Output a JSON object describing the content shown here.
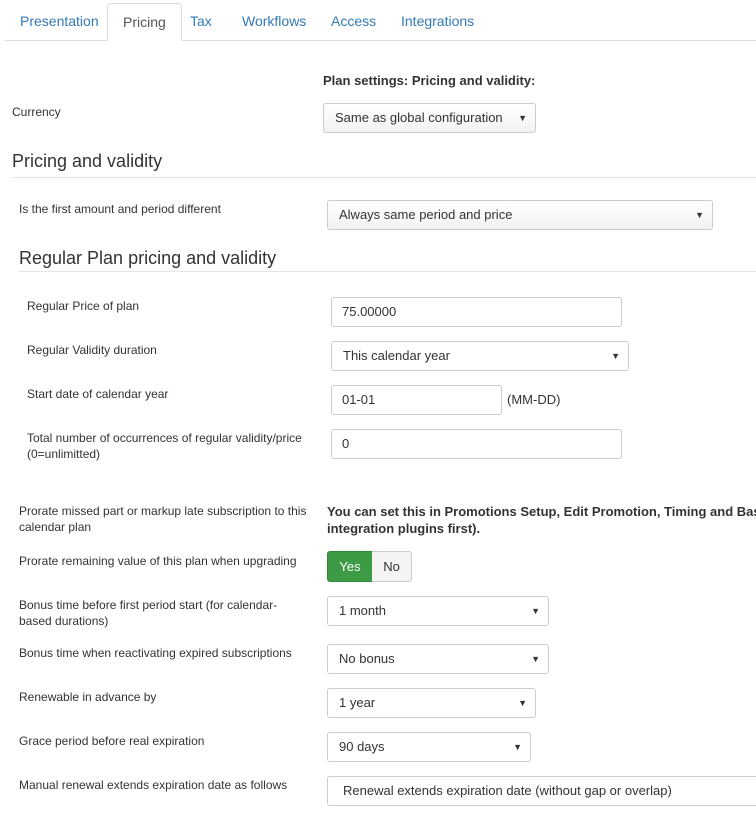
{
  "tabs": [
    {
      "label": "Presentation"
    },
    {
      "label": "Pricing"
    },
    {
      "label": "Tax"
    },
    {
      "label": "Workflows"
    },
    {
      "label": "Access"
    },
    {
      "label": "Integrations"
    }
  ],
  "active_tab": "Pricing",
  "colors": {
    "link": "#337ab7",
    "yes_active": "#3c9b44"
  },
  "plan_settings_header": "Plan settings: Pricing and validity:",
  "currency": {
    "label": "Currency",
    "value": "Same as global configuration"
  },
  "pricing_section": {
    "title": "Pricing and validity"
  },
  "first_amount": {
    "label": "Is the first amount and period different",
    "value": "Always same period and price"
  },
  "regular_section": {
    "title": "Regular Plan pricing and validity"
  },
  "regular_price": {
    "label": "Regular Price of plan",
    "value": "75.00000"
  },
  "regular_validity": {
    "label": "Regular Validity duration",
    "value": "This calendar year"
  },
  "start_date": {
    "label": "Start date of calendar year",
    "value": "01-01",
    "suffix": "(MM-DD)"
  },
  "occurrences": {
    "label_line1": "Total number of occurrences of regular validity/price",
    "label_line2": "(0=unlimitted)",
    "value": "0"
  },
  "prorate_missed": {
    "label_line1": "Prorate missed part or markup late subscription to this",
    "label_line2": "calendar plan",
    "note_line1": "You can set this in Promotions Setup, Edit Promotion, Timing and Bas",
    "note_line2": "integration plugins first)."
  },
  "prorate_upgrade": {
    "label": "Prorate remaining value of this plan when upgrading",
    "yes": "Yes",
    "no": "No",
    "selected": "Yes"
  },
  "bonus_first": {
    "label_line1": "Bonus time before first period start (for calendar-",
    "label_line2": "based durations)",
    "value": "1 month"
  },
  "bonus_reactivate": {
    "label": "Bonus time when reactivating expired subscriptions",
    "value": "No bonus"
  },
  "renewable": {
    "label": "Renewable in advance by",
    "value": "1 year"
  },
  "grace": {
    "label": "Grace period before real expiration",
    "value": "90 days"
  },
  "manual_renewal": {
    "label": "Manual renewal extends expiration date as follows",
    "value": "Renewal extends expiration date (without gap or overlap)"
  }
}
